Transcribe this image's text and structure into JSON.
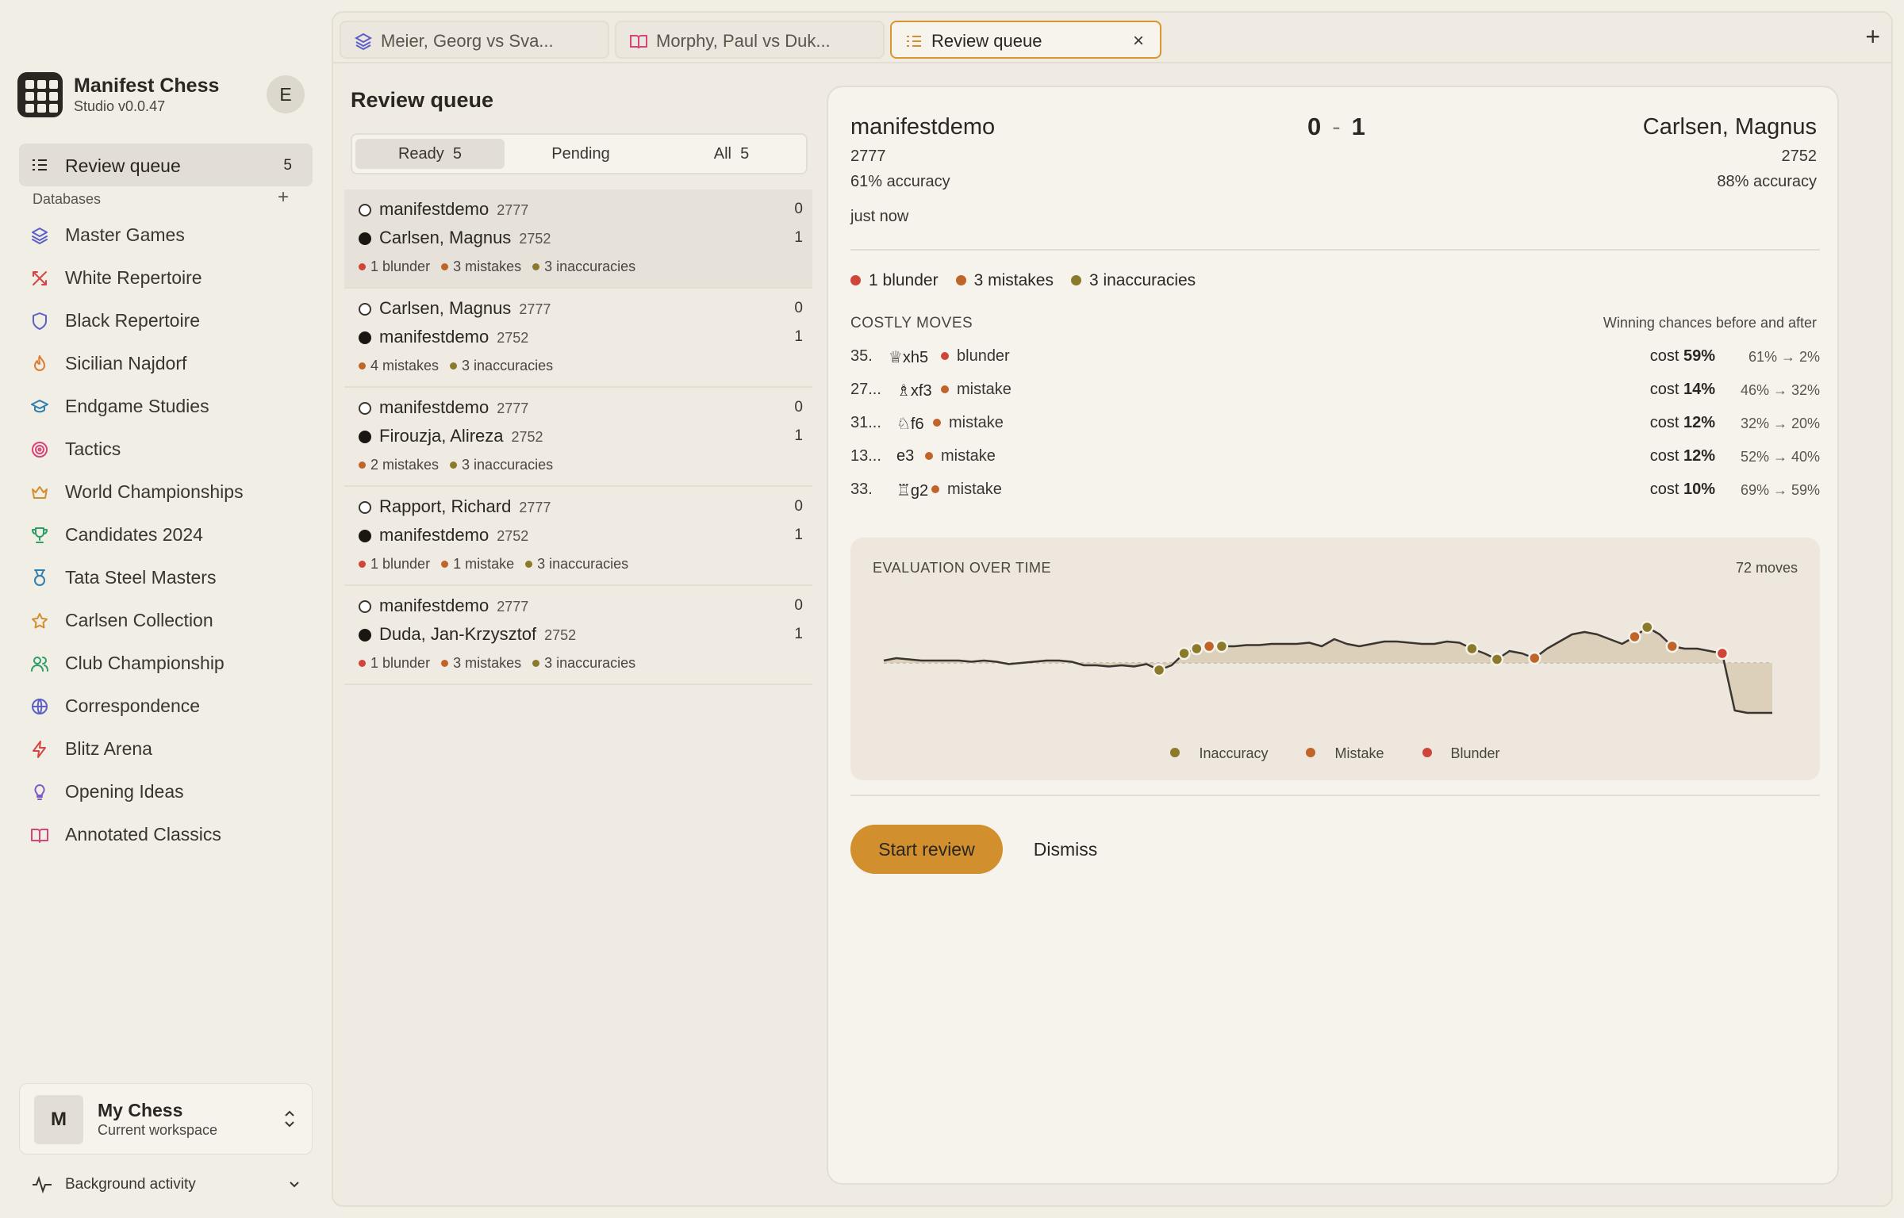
{
  "app": {
    "name": "Manifest Chess",
    "version": "Studio v0.0.47",
    "user_initial": "E"
  },
  "nav": {
    "review_queue_label": "Review queue",
    "review_queue_count": "5"
  },
  "databases": {
    "heading": "Databases",
    "add": "+",
    "items": [
      {
        "label": "Master Games",
        "icon": "layers-icon",
        "color": "#5b5fc7"
      },
      {
        "label": "White Repertoire",
        "icon": "swords-icon",
        "color": "#d64545"
      },
      {
        "label": "Black Repertoire",
        "icon": "shield-icon",
        "color": "#5b5fc7"
      },
      {
        "label": "Sicilian Najdorf",
        "icon": "flame-icon",
        "color": "#e07a2e"
      },
      {
        "label": "Endgame Studies",
        "icon": "graduation-cap-icon",
        "color": "#2f7fb0"
      },
      {
        "label": "Tactics",
        "icon": "target-icon",
        "color": "#d6457a"
      },
      {
        "label": "World Championships",
        "icon": "crown-icon",
        "color": "#d18f2e"
      },
      {
        "label": "Candidates 2024",
        "icon": "trophy-icon",
        "color": "#2e9d6a"
      },
      {
        "label": "Tata Steel Masters",
        "icon": "medal-icon",
        "color": "#2f7fb0"
      },
      {
        "label": "Carlsen Collection",
        "icon": "star-icon",
        "color": "#d18f2e"
      },
      {
        "label": "Club Championship",
        "icon": "users-icon",
        "color": "#2e9d6a"
      },
      {
        "label": "Correspondence",
        "icon": "globe-icon",
        "color": "#5b5fc7"
      },
      {
        "label": "Blitz Arena",
        "icon": "zap-icon",
        "color": "#d64545"
      },
      {
        "label": "Opening Ideas",
        "icon": "lightbulb-icon",
        "color": "#7a5bc7"
      },
      {
        "label": "Annotated Classics",
        "icon": "book-open-icon",
        "color": "#d6457a"
      }
    ]
  },
  "workspace": {
    "initial": "M",
    "name": "My Chess",
    "subtitle": "Current workspace"
  },
  "background_activity": "Background activity",
  "tabs": [
    {
      "label": "Meier, Georg vs Sva...",
      "icon": "layers-icon"
    },
    {
      "label": "Morphy, Paul vs Duk...",
      "icon": "book-open-icon"
    },
    {
      "label": "Review queue",
      "icon": "list-check-icon",
      "close": "×"
    }
  ],
  "tab_add": "+",
  "queue": {
    "title": "Review queue",
    "filters": [
      {
        "label": "Ready",
        "count": "5"
      },
      {
        "label": "Pending",
        "count": ""
      },
      {
        "label": "All",
        "count": "5"
      }
    ],
    "games": [
      {
        "white": "manifestdemo",
        "white_rating": "2777",
        "white_score": "0",
        "black": "Carlsen, Magnus",
        "black_rating": "2752",
        "black_score": "1",
        "tags": [
          {
            "text": "1 blunder",
            "color": "#d0453a"
          },
          {
            "text": "3 mistakes",
            "color": "#c0652a"
          },
          {
            "text": "3 inaccuracies",
            "color": "#8a7a2a"
          }
        ]
      },
      {
        "white": "Carlsen, Magnus",
        "white_rating": "2777",
        "white_score": "0",
        "black": "manifestdemo",
        "black_rating": "2752",
        "black_score": "1",
        "tags": [
          {
            "text": "4 mistakes",
            "color": "#c0652a"
          },
          {
            "text": "3 inaccuracies",
            "color": "#8a7a2a"
          }
        ]
      },
      {
        "white": "manifestdemo",
        "white_rating": "2777",
        "white_score": "0",
        "black": "Firouzja, Alireza",
        "black_rating": "2752",
        "black_score": "1",
        "tags": [
          {
            "text": "2 mistakes",
            "color": "#c0652a"
          },
          {
            "text": "3 inaccuracies",
            "color": "#8a7a2a"
          }
        ]
      },
      {
        "white": "Rapport, Richard",
        "white_rating": "2777",
        "white_score": "0",
        "black": "manifestdemo",
        "black_rating": "2752",
        "black_score": "1",
        "tags": [
          {
            "text": "1 blunder",
            "color": "#d0453a"
          },
          {
            "text": "1 mistake",
            "color": "#c0652a"
          },
          {
            "text": "3 inaccuracies",
            "color": "#8a7a2a"
          }
        ]
      },
      {
        "white": "manifestdemo",
        "white_rating": "2777",
        "white_score": "0",
        "black": "Duda, Jan-Krzysztof",
        "black_rating": "2752",
        "black_score": "1",
        "tags": [
          {
            "text": "1 blunder",
            "color": "#d0453a"
          },
          {
            "text": "3 mistakes",
            "color": "#c0652a"
          },
          {
            "text": "3 inaccuracies",
            "color": "#8a7a2a"
          }
        ]
      }
    ]
  },
  "detail": {
    "white": {
      "name": "manifestdemo",
      "rating": "2777",
      "accuracy": "61% accuracy"
    },
    "black": {
      "name": "Carlsen, Magnus",
      "rating": "2752",
      "accuracy": "88% accuracy"
    },
    "score_white": "0",
    "score_sep": "-",
    "score_black": "1",
    "when": "just now",
    "summary": [
      {
        "text": "1 blunder",
        "color": "#d0453a"
      },
      {
        "text": "3 mistakes",
        "color": "#c0652a"
      },
      {
        "text": "3 inaccuracies",
        "color": "#8a7a2a"
      }
    ],
    "costly_heading": "COSTLY MOVES",
    "costly_subheading": "Winning chances before and after",
    "costly_moves": [
      {
        "num": "35.",
        "san": "♕xh5",
        "kind": "blunder",
        "color": "#d0453a",
        "cost_label": "cost",
        "cost": "59%",
        "change": "61% → 2%"
      },
      {
        "num": "27...",
        "san": "♗xf3",
        "kind": "mistake",
        "color": "#c0652a",
        "cost_label": "cost",
        "cost": "14%",
        "change": "46% → 32%"
      },
      {
        "num": "31...",
        "san": "♘f6",
        "kind": "mistake",
        "color": "#c0652a",
        "cost_label": "cost",
        "cost": "12%",
        "change": "32% → 20%"
      },
      {
        "num": "13...",
        "san": "e3",
        "kind": "mistake",
        "color": "#c0652a",
        "cost_label": "cost",
        "cost": "12%",
        "change": "52% → 40%"
      },
      {
        "num": "33.",
        "san": "♖g2",
        "kind": "mistake",
        "color": "#c0652a",
        "cost_label": "cost",
        "cost": "10%",
        "change": "69% → 59%"
      }
    ],
    "eval_heading": "EVALUATION OVER TIME",
    "eval_moves": "72 moves",
    "legend": [
      {
        "text": "Inaccuracy",
        "color": "#8a7a2a"
      },
      {
        "text": "Mistake",
        "color": "#c0652a"
      },
      {
        "text": "Blunder",
        "color": "#d0453a"
      }
    ],
    "start_review": "Start review",
    "dismiss": "Dismiss"
  },
  "chart_data": {
    "type": "area",
    "title": "EVALUATION OVER TIME",
    "x_label": "72 moves",
    "x_range": [
      0,
      72
    ],
    "y_range": [
      -1,
      1
    ],
    "values": [
      0.02,
      0.04,
      0.03,
      0.02,
      0.02,
      0.02,
      0.02,
      0.01,
      0.02,
      0.01,
      -0.01,
      0.0,
      0.01,
      0.02,
      0.02,
      0.01,
      -0.02,
      -0.02,
      -0.03,
      -0.02,
      -0.03,
      -0.01,
      -0.06,
      -0.02,
      0.08,
      0.12,
      0.14,
      0.14,
      0.14,
      0.15,
      0.15,
      0.16,
      0.16,
      0.16,
      0.17,
      0.14,
      0.2,
      0.16,
      0.14,
      0.16,
      0.18,
      0.18,
      0.17,
      0.16,
      0.16,
      0.18,
      0.17,
      0.12,
      0.08,
      0.03,
      0.1,
      0.08,
      0.04,
      0.12,
      0.18,
      0.24,
      0.26,
      0.24,
      0.2,
      0.16,
      0.22,
      0.3,
      0.24,
      0.14,
      0.12,
      0.12,
      0.1,
      0.08,
      -0.4,
      -0.42,
      -0.42,
      -0.42
    ],
    "markers": [
      {
        "move": 22,
        "kind": "inaccuracy"
      },
      {
        "move": 24,
        "kind": "inaccuracy"
      },
      {
        "move": 25,
        "kind": "inaccuracy"
      },
      {
        "move": 26,
        "kind": "mistake"
      },
      {
        "move": 27,
        "kind": "inaccuracy"
      },
      {
        "move": 47,
        "kind": "inaccuracy"
      },
      {
        "move": 49,
        "kind": "inaccuracy"
      },
      {
        "move": 52,
        "kind": "mistake"
      },
      {
        "move": 60,
        "kind": "mistake"
      },
      {
        "move": 61,
        "kind": "inaccuracy"
      },
      {
        "move": 63,
        "kind": "mistake"
      },
      {
        "move": 67,
        "kind": "blunder"
      }
    ]
  }
}
